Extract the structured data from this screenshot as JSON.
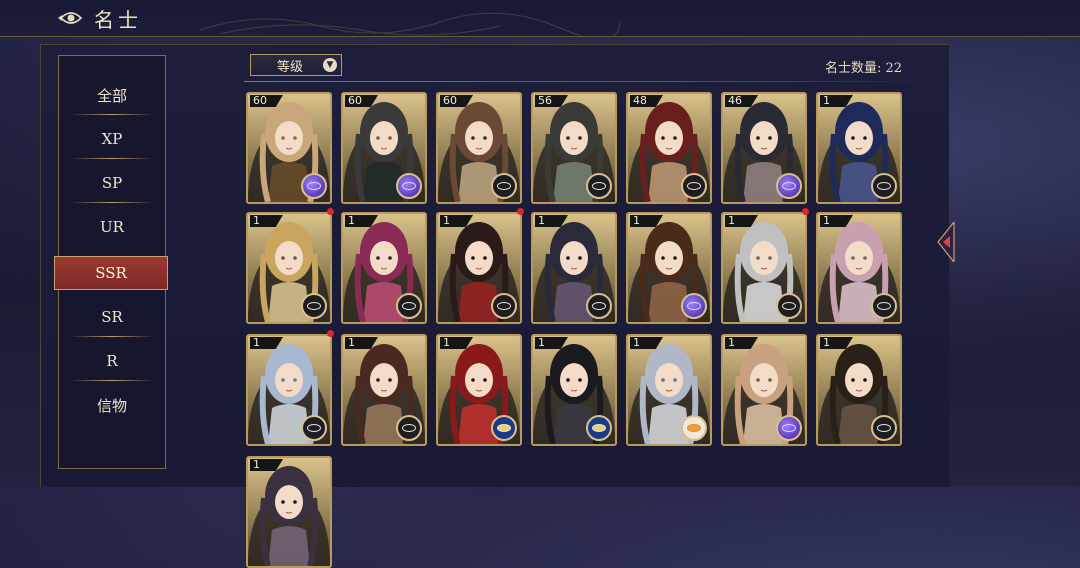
{
  "header": {
    "title": "名士"
  },
  "sidebar": {
    "items": [
      {
        "label": "全部",
        "active": false
      },
      {
        "label": "XP",
        "active": false
      },
      {
        "label": "SP",
        "active": false
      },
      {
        "label": "UR",
        "active": false
      },
      {
        "label": "SSR",
        "active": true
      },
      {
        "label": "SR",
        "active": false
      },
      {
        "label": "R",
        "active": false
      },
      {
        "label": "信物",
        "active": false
      }
    ]
  },
  "toolbar": {
    "sort_label": "等级",
    "sort_icon": "chevron-down-icon",
    "count_text": "名士数量: 22"
  },
  "colors": {
    "active_tab": "#8c3330",
    "card_border": "#b89a5a",
    "red_dot": "#e0242a"
  },
  "cards": [
    {
      "level": "60",
      "badge": "purple-orb-icon",
      "dot": false
    },
    {
      "level": "60",
      "badge": "purple-orb-icon",
      "dot": false
    },
    {
      "level": "60",
      "badge": "eye-badge-icon",
      "dot": false
    },
    {
      "level": "56",
      "badge": "eye-badge-icon",
      "dot": false
    },
    {
      "level": "48",
      "badge": "eye-badge-icon",
      "dot": false
    },
    {
      "level": "46",
      "badge": "purple-orb-icon",
      "dot": false
    },
    {
      "level": "1",
      "badge": "eye-badge-icon",
      "dot": false
    },
    {
      "level": "1",
      "badge": "eye-badge-icon",
      "dot": true
    },
    {
      "level": "1",
      "badge": "eye-badge-icon",
      "dot": false
    },
    {
      "level": "1",
      "badge": "eye-badge-icon",
      "dot": true
    },
    {
      "level": "1",
      "badge": "eye-badge-icon",
      "dot": false
    },
    {
      "level": "1",
      "badge": "purple-orb-icon",
      "dot": false
    },
    {
      "level": "1",
      "badge": "eye-badge-icon",
      "dot": true
    },
    {
      "level": "1",
      "badge": "eye-badge-icon",
      "dot": false
    },
    {
      "level": "1",
      "badge": "eye-badge-icon",
      "dot": true
    },
    {
      "level": "1",
      "badge": "eye-badge-icon",
      "dot": false
    },
    {
      "level": "1",
      "badge": "blue-eye-badge-icon",
      "dot": false
    },
    {
      "level": "1",
      "badge": "blue-eye-badge-icon",
      "dot": false
    },
    {
      "level": "1",
      "badge": "sun-badge-icon",
      "dot": false
    },
    {
      "level": "1",
      "badge": "purple-orb-icon",
      "dot": false
    },
    {
      "level": "1",
      "badge": "eye-badge-icon",
      "dot": false
    },
    {
      "level": "1",
      "badge": "",
      "dot": false
    }
  ]
}
